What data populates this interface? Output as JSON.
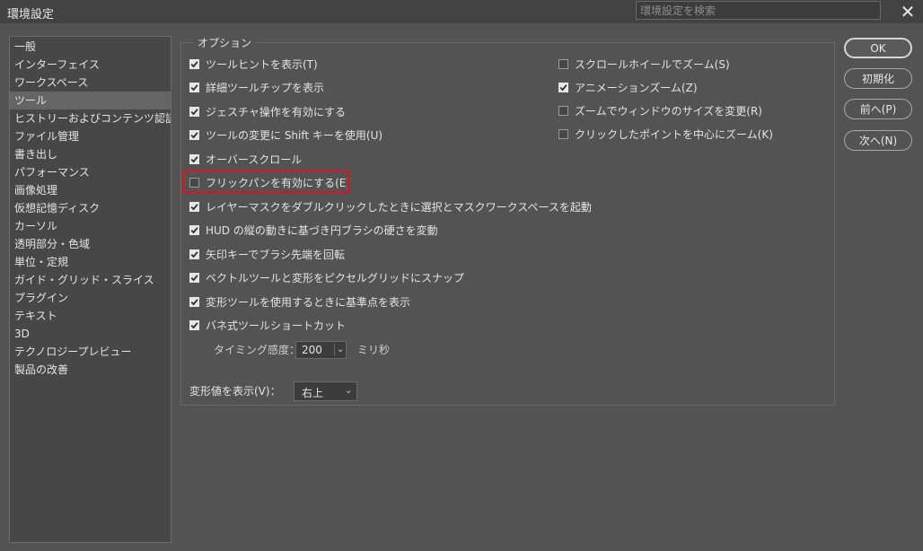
{
  "window": {
    "title": "環境設定",
    "search_placeholder": "環境設定を検索",
    "close_glyph": "✕"
  },
  "sidebar": {
    "selected_index": 3,
    "items": [
      {
        "label": "一般"
      },
      {
        "label": "インターフェイス"
      },
      {
        "label": "ワークスペース"
      },
      {
        "label": "ツール"
      },
      {
        "label": "ヒストリーおよびコンテンツ認証情報"
      },
      {
        "label": "ファイル管理"
      },
      {
        "label": "書き出し"
      },
      {
        "label": "パフォーマンス"
      },
      {
        "label": "画像処理"
      },
      {
        "label": "仮想記憶ディスク"
      },
      {
        "label": "カーソル"
      },
      {
        "label": "透明部分・色域"
      },
      {
        "label": "単位・定規"
      },
      {
        "label": "ガイド・グリッド・スライス"
      },
      {
        "label": "プラグイン"
      },
      {
        "label": "テキスト"
      },
      {
        "label": "3D"
      },
      {
        "label": "テクノロジープレビュー"
      },
      {
        "label": "製品の改善"
      }
    ]
  },
  "options": {
    "group_title": "オプション",
    "left_column": [
      {
        "label": "ツールヒントを表示(T)",
        "checked": true
      },
      {
        "label": "詳細ツールチップを表示",
        "checked": true
      },
      {
        "label": "ジェスチャ操作を有効にする",
        "checked": true
      },
      {
        "label": "ツールの変更に Shift キーを使用(U)",
        "checked": true
      },
      {
        "label": "オーバースクロール",
        "checked": true
      },
      {
        "label": "フリックパンを有効にする(E)",
        "checked": false
      },
      {
        "label": "レイヤーマスクをダブルクリックしたときに選択とマスクワークスペースを起動",
        "checked": true
      },
      {
        "label": "HUD の縦の動きに基づき円ブラシの硬さを変動",
        "checked": true
      },
      {
        "label": "矢印キーでブラシ先端を回転",
        "checked": true
      },
      {
        "label": "ベクトルツールと変形をピクセルグリッドにスナップ",
        "checked": true
      },
      {
        "label": "変形ツールを使用するときに基準点を表示",
        "checked": true
      },
      {
        "label": "バネ式ツールショートカット",
        "checked": true
      }
    ],
    "right_column": [
      {
        "label": "スクロールホイールでズーム(S)",
        "checked": false
      },
      {
        "label": "アニメーションズーム(Z)",
        "checked": true
      },
      {
        "label": "ズームでウィンドウのサイズを変更(R)",
        "checked": false
      },
      {
        "label": "クリックしたポイントを中心にズーム(K)",
        "checked": false
      }
    ],
    "timing": {
      "label": "タイミング感度：",
      "value": "200",
      "unit": "ミリ秒"
    },
    "transform_values": {
      "label": "変形値を表示(V)：",
      "value": "右上"
    }
  },
  "buttons": {
    "ok": "OK",
    "reset": "初期化",
    "prev": "前へ(P)",
    "next": "次へ(N)"
  },
  "colors": {
    "background": "#535353",
    "titlebar": "#424242",
    "highlight_box": "#e0111b"
  }
}
